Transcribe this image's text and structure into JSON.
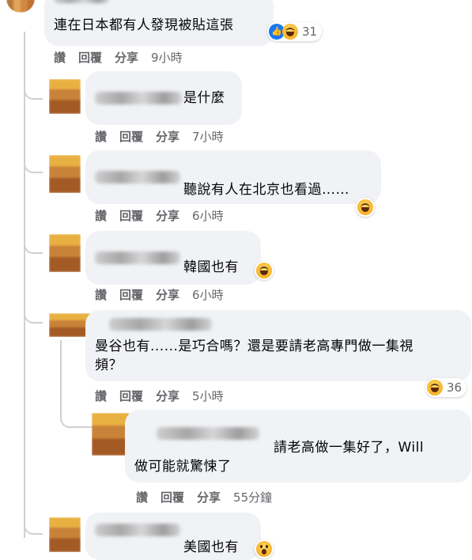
{
  "comments": [
    {
      "text": "連在日本都有人發現被貼這張",
      "reaction_count": "31",
      "reactions": [
        "like-icon",
        "haha-icon"
      ],
      "time": "9小時"
    },
    {
      "text": "是什麼",
      "time": "7小時"
    },
    {
      "text": "聽說有人在北京也看過……",
      "time": "6小時"
    },
    {
      "text": "韓國也有",
      "time": "6小時"
    },
    {
      "text_line1": "曼谷也有......是巧合嗎？還是要請老高專門做一集視",
      "text_line2": "頻？",
      "reaction_count": "36",
      "time": "5小時"
    },
    {
      "text_line1": "請老高做一集好了，Will",
      "text_line2": "做可能就驚悚了",
      "time": "55分鐘"
    },
    {
      "text": "美國也有"
    }
  ],
  "actions": {
    "like": "讚",
    "reply": "回覆",
    "share": "分享"
  },
  "colors": {
    "bubble": "#f0f2f5",
    "meta": "#65676b",
    "thread": "#ced0d4",
    "like": "#1877f2",
    "haha": "#f7b125"
  }
}
